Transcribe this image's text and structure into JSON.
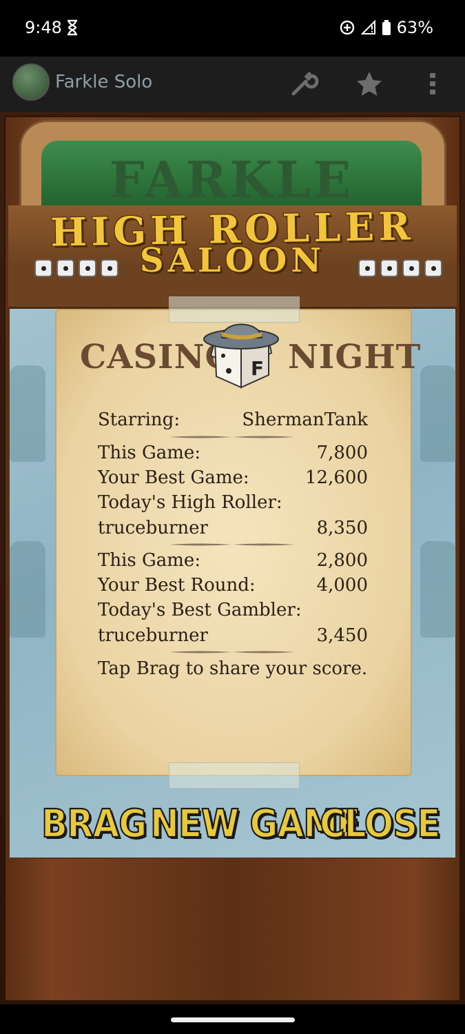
{
  "status": {
    "time": "9:48",
    "battery": "63%"
  },
  "app": {
    "title": "Farkle Solo"
  },
  "sign": {
    "top_word": "FARKLE",
    "title_line1": "HIGH ROLLER",
    "title_line2": "SALOON"
  },
  "card": {
    "casino": "CASINO",
    "night": "NIGHT",
    "die_letter": "F",
    "starring_label": "Starring:",
    "starring_value": "ShermanTank",
    "game": {
      "this_label": "This Game:",
      "this_value": "7,800",
      "best_label": "Your Best Game:",
      "best_value": "12,600",
      "today_label": "Today's High Roller:",
      "today_name": "truceburner",
      "today_value": "8,350"
    },
    "round": {
      "this_label": "This Game:",
      "this_value": "2,800",
      "best_label": "Your Best Round:",
      "best_value": "4,000",
      "today_label": "Today's Best Gambler:",
      "today_name": "truceburner",
      "today_value": "3,450"
    },
    "hint": "Tap Brag to share your score."
  },
  "buttons": {
    "brag": "BRAG",
    "new_game": "NEW GAME",
    "close": "CLOSE"
  },
  "icons": {
    "hourglass": "hourglass-icon",
    "data_saver": "data-saver-icon",
    "signal": "signal-icon",
    "battery": "battery-icon",
    "settings": "wrench-icon",
    "favorite": "star-icon",
    "overflow": "more-vert-icon"
  },
  "colors": {
    "button_yellow": "#e8c93c",
    "title_gold": "#f2c53a",
    "paper": "#f0ddb4"
  }
}
